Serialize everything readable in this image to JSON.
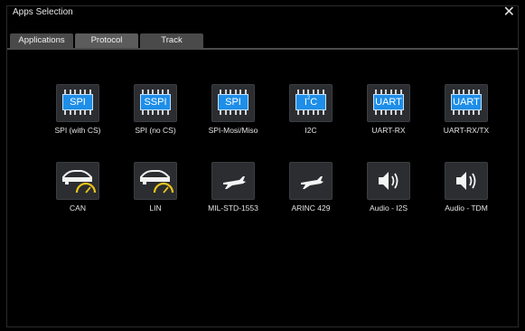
{
  "window": {
    "title": "Apps Selection",
    "close_label": "✕"
  },
  "tabs": [
    {
      "label": "Applications",
      "active": false
    },
    {
      "label": "Protocol",
      "active": true
    },
    {
      "label": "Track",
      "active": false
    }
  ],
  "apps": [
    {
      "label": "SPI (with CS)",
      "icon": "spi-chip-icon",
      "chip_text": "SPI"
    },
    {
      "label": "SPI (no CS)",
      "icon": "sspi-chip-icon",
      "chip_text": "SSPI"
    },
    {
      "label": "SPI-Mosi/Miso",
      "icon": "spi-chip-icon",
      "chip_text": "SPI"
    },
    {
      "label": "I2C",
      "icon": "i2c-chip-icon",
      "chip_text": "I",
      "chip_sup": "2",
      "chip_suffix": "C"
    },
    {
      "label": "UART-RX",
      "icon": "uart-chip-icon",
      "chip_text": "UART"
    },
    {
      "label": "UART-RX/TX",
      "icon": "uart-chip-icon",
      "chip_text": "UART"
    },
    {
      "label": "CAN",
      "icon": "car-gauge-icon"
    },
    {
      "label": "LIN",
      "icon": "car-gauge-icon"
    },
    {
      "label": "MIL-STD-1553",
      "icon": "airplane-icon"
    },
    {
      "label": "ARINC 429",
      "icon": "airplane-icon"
    },
    {
      "label": "Audio - I2S",
      "icon": "speaker-icon"
    },
    {
      "label": "Audio - TDM",
      "icon": "speaker-icon"
    }
  ],
  "colors": {
    "chip_blue": "#1e8ee8",
    "gauge_yellow": "#e8c21a",
    "tab_bg": "#4a4a4a"
  }
}
